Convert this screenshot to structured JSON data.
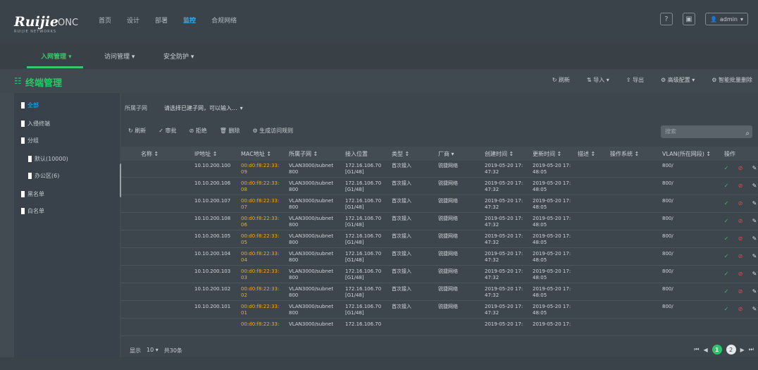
{
  "app": {
    "logo": "Ruijie",
    "product": "ONC",
    "logo_tag": "RUIJIE NETWORKS"
  },
  "nav": [
    {
      "label": "首页",
      "active": false
    },
    {
      "label": "设计",
      "active": false
    },
    {
      "label": "部署",
      "active": false
    },
    {
      "label": "监控",
      "active": true
    },
    {
      "label": "合规网络",
      "active": false
    }
  ],
  "top_right": {
    "user": "admin"
  },
  "subtabs": [
    {
      "label": "入网管理",
      "active": true
    },
    {
      "label": "访问管理",
      "active": false
    },
    {
      "label": "安全防护",
      "active": false
    }
  ],
  "page": {
    "title": "终端管理"
  },
  "actions": [
    {
      "label": "刷新",
      "icon": "refresh-icon"
    },
    {
      "label": "导入",
      "icon": "import-icon"
    },
    {
      "label": "导出",
      "icon": "export-icon"
    },
    {
      "label": "高级配置",
      "icon": "gear-icon"
    },
    {
      "label": "智能批量删除",
      "icon": "gear-icon"
    }
  ],
  "sidebar": [
    {
      "label": "全部",
      "selected": true,
      "depth": 0
    },
    {
      "label": "入侵终端",
      "selected": false,
      "depth": 0
    },
    {
      "label": "分组",
      "selected": false,
      "depth": 0
    },
    {
      "label": "默认(10000)",
      "selected": false,
      "depth": 1
    },
    {
      "label": "办公区(6)",
      "selected": false,
      "depth": 1
    },
    {
      "label": "黑名单",
      "selected": false,
      "depth": 0
    },
    {
      "label": "白名单",
      "selected": false,
      "depth": 0
    }
  ],
  "filter": {
    "label": "所属子网",
    "value": "请选择已建子网，可以输入..."
  },
  "toolbar": [
    {
      "label": "刷新"
    },
    {
      "label": "审批"
    },
    {
      "label": "拒绝"
    },
    {
      "label": "删除"
    },
    {
      "label": "生成访问规则"
    }
  ],
  "search": {
    "placeholder": "搜索"
  },
  "columns": [
    "名称 ↕",
    "IP地址 ↕",
    "MAC地址 ↕",
    "所属子网 ↕",
    "接入位置",
    "类型 ↕",
    "厂商 ▾",
    "创建时间 ↕",
    "更新时间 ↕",
    "描述 ↕",
    "操作系统 ↕",
    "VLAN(所在网段) ↕",
    "操作"
  ],
  "rows": [
    {
      "ip": "10.10.200.100",
      "mac": [
        "00:d0:f8:22:33:",
        "09"
      ],
      "subnet": [
        "VLAN3000/subnet",
        "800"
      ],
      "loc": [
        "172.16.106.70",
        "[G1/48]"
      ],
      "type": "首次接入",
      "vendor": "锐捷网络",
      "created": [
        "2019-05-20 17:",
        "47:32"
      ],
      "updated": [
        "2019-05-20 17:",
        "48:05"
      ],
      "vlan": "800/"
    },
    {
      "ip": "10.10.200.106",
      "mac": [
        "00:d0:f8:22:33:",
        "08"
      ],
      "subnet": [
        "VLAN3000/subnet",
        "800"
      ],
      "loc": [
        "172.16.106.70",
        "[G1/48]"
      ],
      "type": "首次接入",
      "vendor": "锐捷网络",
      "created": [
        "2019-05-20 17:",
        "47:32"
      ],
      "updated": [
        "2019-05-20 17:",
        "48:05"
      ],
      "vlan": "800/"
    },
    {
      "ip": "10.10.200.107",
      "mac": [
        "00:d0:f8:22:33:",
        "07"
      ],
      "subnet": [
        "VLAN3000/subnet",
        "800"
      ],
      "loc": [
        "172.16.106.70",
        "[G1/48]"
      ],
      "type": "首次接入",
      "vendor": "锐捷网络",
      "created": [
        "2019-05-20 17:",
        "47:32"
      ],
      "updated": [
        "2019-05-20 17:",
        "48:05"
      ],
      "vlan": "800/"
    },
    {
      "ip": "10.10.200.108",
      "mac": [
        "00:d0:f8:22:33:",
        "06"
      ],
      "subnet": [
        "VLAN3000/subnet",
        "800"
      ],
      "loc": [
        "172.16.106.70",
        "[G1/48]"
      ],
      "type": "首次接入",
      "vendor": "锐捷网络",
      "created": [
        "2019-05-20 17:",
        "47:32"
      ],
      "updated": [
        "2019-05-20 17:",
        "48:05"
      ],
      "vlan": "800/"
    },
    {
      "ip": "10.10.200.105",
      "mac": [
        "00:d0:f8:22:33:",
        "05"
      ],
      "subnet": [
        "VLAN3000/subnet",
        "800"
      ],
      "loc": [
        "172.16.106.70",
        "[G1/48]"
      ],
      "type": "首次接入",
      "vendor": "锐捷网络",
      "created": [
        "2019-05-20 17:",
        "47:32"
      ],
      "updated": [
        "2019-05-20 17:",
        "48:05"
      ],
      "vlan": "800/"
    },
    {
      "ip": "10.10.200.104",
      "mac": [
        "00:d0:f8:22:33:",
        "04"
      ],
      "subnet": [
        "VLAN3000/subnet",
        "800"
      ],
      "loc": [
        "172.16.106.70",
        "[G1/48]"
      ],
      "type": "首次接入",
      "vendor": "锐捷网络",
      "created": [
        "2019-05-20 17:",
        "47:32"
      ],
      "updated": [
        "2019-05-20 17:",
        "48:05"
      ],
      "vlan": "800/"
    },
    {
      "ip": "10.10.200.103",
      "mac": [
        "00:d0:f8:22:33:",
        "03"
      ],
      "subnet": [
        "VLAN3000/subnet",
        "800"
      ],
      "loc": [
        "172.16.106.70",
        "[G1/48]"
      ],
      "type": "首次接入",
      "vendor": "锐捷网络",
      "created": [
        "2019-05-20 17:",
        "47:32"
      ],
      "updated": [
        "2019-05-20 17:",
        "48:05"
      ],
      "vlan": "800/"
    },
    {
      "ip": "10.10.200.102",
      "mac": [
        "00:d0:f8:22:33:",
        "02"
      ],
      "subnet": [
        "VLAN3000/subnet",
        "800"
      ],
      "loc": [
        "172.16.106.70",
        "[G1/48]"
      ],
      "type": "首次接入",
      "vendor": "锐捷网络",
      "created": [
        "2019-05-20 17:",
        "47:32"
      ],
      "updated": [
        "2019-05-20 17:",
        "48:05"
      ],
      "vlan": "800/"
    },
    {
      "ip": "10.10.200.101",
      "mac": [
        "00:d0:f8:22:33:",
        "01"
      ],
      "subnet": [
        "VLAN3000/subnet",
        "800"
      ],
      "loc": [
        "172.16.106.70",
        "[G1/48]"
      ],
      "type": "首次接入",
      "vendor": "锐捷网络",
      "created": [
        "2019-05-20 17:",
        "47:32"
      ],
      "updated": [
        "2019-05-20 17:",
        "48:05"
      ],
      "vlan": "800/"
    },
    {
      "ip": "",
      "mac": [
        "00:d0:f8:22:33:",
        ""
      ],
      "subnet": [
        "VLAN3000/subnet",
        ""
      ],
      "loc": [
        "172.16.106.70",
        ""
      ],
      "type": "",
      "vendor": "",
      "created": [
        "2019-05-20 17:",
        ""
      ],
      "updated": [
        "2019-05-20 17:",
        ""
      ],
      "vlan": ""
    }
  ],
  "pager": {
    "total_label": "显示",
    "page_size": "10 ▾",
    "total": "共30条",
    "pages": [
      "1",
      "2"
    ],
    "current": "1"
  }
}
